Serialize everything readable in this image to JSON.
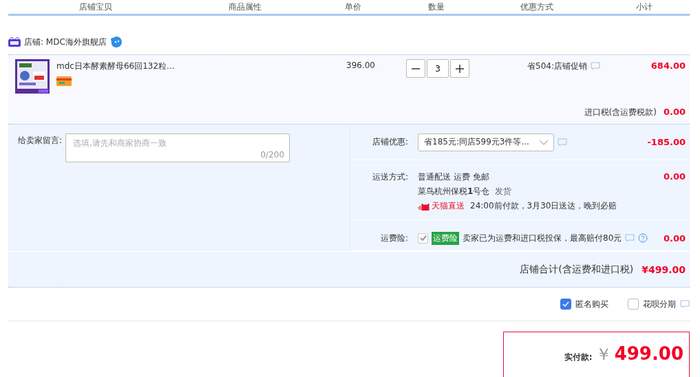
{
  "columns": [
    "店铺宝贝",
    "商品属性",
    "单价",
    "数量",
    "优惠方式",
    "小计"
  ],
  "shop": {
    "label": "店铺: MDC海外旗舰店"
  },
  "item": {
    "title": "mdc日本酵素酵母66回132粒...",
    "price": "396.00",
    "quantity": "3",
    "promo": "省504:店铺促销",
    "subtotal": "684.00",
    "tax_label": "进口税(含运费税款)",
    "tax": "0.00"
  },
  "message": {
    "label": "给卖家留言:",
    "placeholder": "选填,请先和商家协商一致",
    "counter": "0/200"
  },
  "coupon": {
    "label": "店铺优惠:",
    "value": "省185元:同店599元3件等...",
    "amount": "-185.00"
  },
  "shipping": {
    "label": "运送方式:",
    "method": "普通配送 运费 免邮",
    "warehouse": "菜鸟杭州保税**1**号仓",
    "dispatch": "发货",
    "badge": "天猫直送",
    "promise": "24:00前付款，3月30日送达，晚到必赔",
    "amount": "0.00"
  },
  "insurance": {
    "label": "运费险:",
    "checked": true,
    "disabled": true,
    "tag": "运费险",
    "text": "卖家已为运费和进口税投保，最高赔付80元",
    "amount": "0.00"
  },
  "store_total": {
    "label": "店铺合计(含运费和进口税)",
    "amount": "¥499.00"
  },
  "options": [
    {
      "label": "匿名购买",
      "checked": true,
      "info": false
    },
    {
      "label": "花呗分期",
      "checked": false,
      "info": true
    }
  ],
  "payment": {
    "label": "实付款:",
    "currency": "￥",
    "amount": "499.00"
  }
}
